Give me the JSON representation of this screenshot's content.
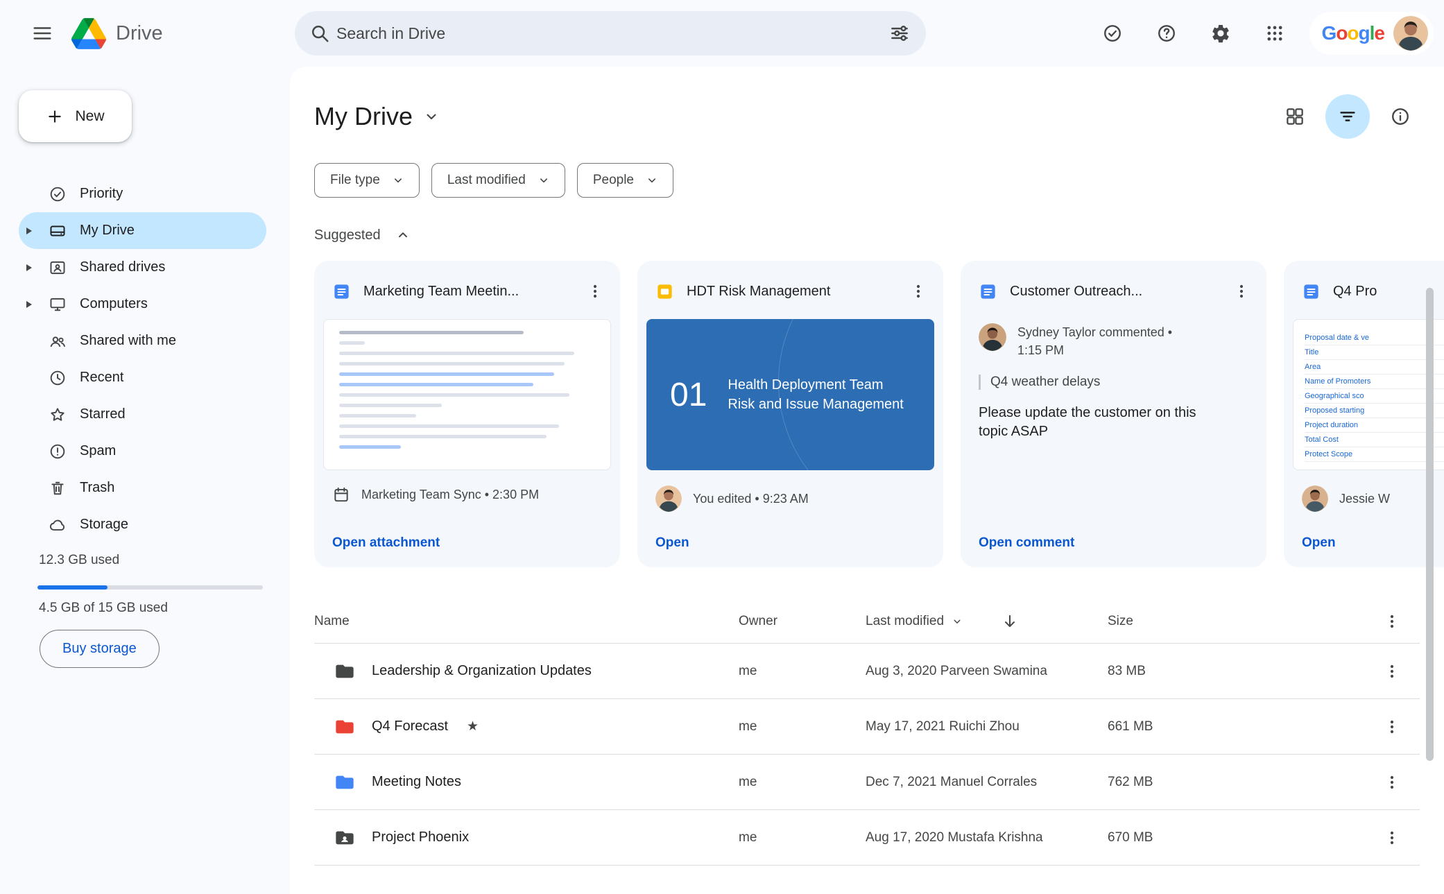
{
  "colors": {
    "accent_blue": "#0b57d0",
    "selected_nav_bg": "#c2e7ff",
    "search_bg": "#e9eef6",
    "page_bg": "#f8fafd",
    "card_bg": "#f4f8fc",
    "slide_blue": "#2d6db4",
    "storage_fill_blue": "#1a73e8"
  },
  "topbar": {
    "app_name": "Drive",
    "search_placeholder": "Search in Drive",
    "google_letters": [
      "G",
      "o",
      "o",
      "g",
      "l",
      "e"
    ]
  },
  "sidebar": {
    "new_button_label": "New",
    "items": [
      {
        "label": "Priority"
      },
      {
        "label": "My Drive",
        "selected": true
      },
      {
        "label": "Shared drives"
      },
      {
        "label": "Computers"
      },
      {
        "label": "Shared with me"
      },
      {
        "label": "Recent"
      },
      {
        "label": "Starred"
      },
      {
        "label": "Spam"
      },
      {
        "label": "Trash"
      },
      {
        "label": "Storage"
      }
    ],
    "storage": {
      "used_heading": "12.3 GB used",
      "quota_text": "4.5 GB of 15 GB used",
      "buy_button_label": "Buy storage",
      "percent_used": 31
    }
  },
  "main": {
    "title": "My Drive",
    "filter_chips": [
      {
        "label": "File type"
      },
      {
        "label": "Last modified"
      },
      {
        "label": "People"
      }
    ],
    "suggested_heading": "Suggested",
    "cards": [
      {
        "file_type": "google-docs",
        "title": "Marketing Team Meetin...",
        "meta": "Marketing Team Sync • 2:30 PM",
        "action_label": "Open attachment"
      },
      {
        "file_type": "google-slides",
        "title": "HDT Risk Management",
        "slide_number": "01",
        "slide_line1": "Health Deployment Team",
        "slide_line2": "Risk and Issue Management",
        "meta": "You edited • 9:23 AM",
        "action_label": "Open"
      },
      {
        "file_type": "google-docs",
        "title": "Customer Outreach...",
        "comment_meta": "Sydney Taylor commented • 1:15 PM",
        "comment_quote": "Q4 weather delays",
        "comment_body": "Please update the customer on this topic ASAP",
        "action_label": "Open comment"
      },
      {
        "file_type": "google-docs",
        "title": "Q4 Pro",
        "preview_rows": [
          "Proposal date & ve",
          "Title",
          "Area",
          "Name of Promoters",
          "Geographical sco",
          "Proposed starting",
          "Project duration",
          "Total Cost",
          "Protect Scope"
        ],
        "meta": "Jessie W",
        "action_label": "Open"
      }
    ],
    "table": {
      "headers": {
        "name": "Name",
        "owner": "Owner",
        "modified": "Last modified",
        "size": "Size"
      },
      "rows": [
        {
          "name": "Leadership & Organization Updates",
          "owner": "me",
          "modified": "Aug 3, 2020 Parveen Swamina",
          "size": "83 MB",
          "folder_color": "#444746"
        },
        {
          "name": "Q4 Forecast",
          "owner": "me",
          "modified": "May 17, 2021 Ruichi Zhou",
          "size": "661 MB",
          "folder_color": "#ea4335",
          "starred": true
        },
        {
          "name": "Meeting Notes",
          "owner": "me",
          "modified": "Dec 7, 2021 Manuel Corrales",
          "size": "762 MB",
          "folder_color": "#4285f4"
        },
        {
          "name": "Project Phoenix",
          "owner": "me",
          "modified": "Aug 17, 2020 Mustafa Krishna",
          "size": "670 MB",
          "folder_color": "#444746",
          "shared": true
        }
      ]
    }
  }
}
